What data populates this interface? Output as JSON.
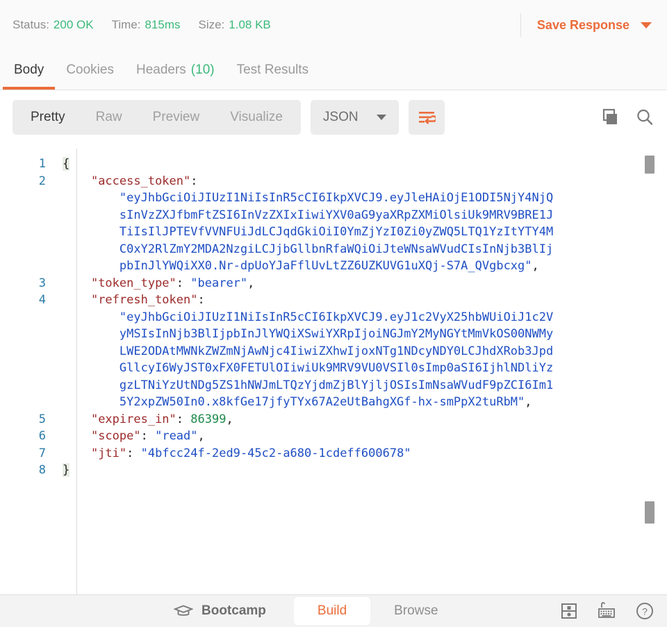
{
  "status_bar": {
    "status_label": "Status:",
    "status_value": "200 OK",
    "time_label": "Time:",
    "time_value": "815ms",
    "size_label": "Size:",
    "size_value": "1.08 KB",
    "save_response_label": "Save Response",
    "save_caret_icon": "chevron-down-icon",
    "accent_color": "#eb6c3a",
    "success_color": "#3bb97a"
  },
  "tabs": [
    {
      "label": "Body",
      "active": true,
      "count": ""
    },
    {
      "label": "Cookies",
      "active": false,
      "count": ""
    },
    {
      "label": "Headers",
      "active": false,
      "count": "(10)"
    },
    {
      "label": "Test Results",
      "active": false,
      "count": ""
    }
  ],
  "body_toolbar": {
    "view_modes": [
      {
        "label": "Pretty",
        "active": true
      },
      {
        "label": "Raw",
        "active": false
      },
      {
        "label": "Preview",
        "active": false
      },
      {
        "label": "Visualize",
        "active": false
      }
    ],
    "format_selected": "JSON",
    "format_caret_icon": "chevron-down-icon",
    "wrap_icon": "word-wrap-icon",
    "copy_icon": "copy-icon",
    "search_icon": "search-icon"
  },
  "code": {
    "language": "json",
    "line_numbers": [
      "1",
      "2",
      "",
      "",
      "",
      "",
      "",
      "3",
      "4",
      "",
      "",
      "",
      "",
      "",
      "5",
      "6",
      "7",
      "8"
    ],
    "lines": [
      {
        "num": "1",
        "segments": [
          {
            "t": "{",
            "c": "brace-hl"
          }
        ]
      },
      {
        "num": "2",
        "segments": [
          {
            "t": "    ",
            "c": "p"
          },
          {
            "t": "\"access_token\"",
            "c": "k"
          },
          {
            "t": ":",
            "c": "p"
          }
        ]
      },
      {
        "num": "",
        "segments": [
          {
            "t": "        ",
            "c": "p"
          },
          {
            "t": "\"eyJhbGciOiJIUzI1NiIsInR5cCI6IkpXVCJ9.eyJleHAiOjE1ODI5NjY4NjQ",
            "c": "s"
          }
        ]
      },
      {
        "num": "",
        "segments": [
          {
            "t": "        ",
            "c": "p"
          },
          {
            "t": "sInVzZXJfbmFtZSI6InVzZXIxIiwiYXV0aG9yaXRpZXMiOlsiUk9MRV9BRE1J",
            "c": "s"
          }
        ]
      },
      {
        "num": "",
        "segments": [
          {
            "t": "        ",
            "c": "p"
          },
          {
            "t": "TiIsIlJPTEVfVVNFUiJdLCJqdGkiOiI0YmZjYzI0Zi0yZWQ5LTQ1YzItYTY4M",
            "c": "s"
          }
        ]
      },
      {
        "num": "",
        "segments": [
          {
            "t": "        ",
            "c": "p"
          },
          {
            "t": "C0xY2RlZmY2MDA2NzgiLCJjbGllbnRfaWQiOiJteWNsaWVudCIsInNjb3BlIj",
            "c": "s"
          }
        ]
      },
      {
        "num": "",
        "segments": [
          {
            "t": "        ",
            "c": "p"
          },
          {
            "t": "pbInJlYWQiXX0.Nr-dpUoYJaFflUvLtZZ6UZKUVG1uXQj-S7A_QVgbcxg\"",
            "c": "s"
          },
          {
            "t": ",",
            "c": "p"
          }
        ]
      },
      {
        "num": "3",
        "segments": [
          {
            "t": "    ",
            "c": "p"
          },
          {
            "t": "\"token_type\"",
            "c": "k"
          },
          {
            "t": ": ",
            "c": "p"
          },
          {
            "t": "\"bearer\"",
            "c": "s"
          },
          {
            "t": ",",
            "c": "p"
          }
        ]
      },
      {
        "num": "4",
        "segments": [
          {
            "t": "    ",
            "c": "p"
          },
          {
            "t": "\"refresh_token\"",
            "c": "k"
          },
          {
            "t": ":",
            "c": "p"
          }
        ]
      },
      {
        "num": "",
        "segments": [
          {
            "t": "        ",
            "c": "p"
          },
          {
            "t": "\"eyJhbGciOiJIUzI1NiIsInR5cCI6IkpXVCJ9.eyJ1c2VyX25hbWUiOiJ1c2V",
            "c": "s"
          }
        ]
      },
      {
        "num": "",
        "segments": [
          {
            "t": "        ",
            "c": "p"
          },
          {
            "t": "yMSIsInNjb3BlIjpbInJlYWQiXSwiYXRpIjoiNGJmY2MyNGYtMmVkOS00NWMy",
            "c": "s"
          }
        ]
      },
      {
        "num": "",
        "segments": [
          {
            "t": "        ",
            "c": "p"
          },
          {
            "t": "LWE2ODAtMWNkZWZmNjAwNjc4IiwiZXhwIjoxNTg1NDcyNDY0LCJhdXRob3Jpd",
            "c": "s"
          }
        ]
      },
      {
        "num": "",
        "segments": [
          {
            "t": "        ",
            "c": "p"
          },
          {
            "t": "GllcyI6WyJST0xFX0FETUlOIiwiUk9MRV9VU0VSIl0sImp0aSI6IjhlNDliYz",
            "c": "s"
          }
        ]
      },
      {
        "num": "",
        "segments": [
          {
            "t": "        ",
            "c": "p"
          },
          {
            "t": "gzLTNiYzUtNDg5ZS1hNWJmLTQzYjdmZjBlYjljOSIsImNsaWVudF9pZCI6Im1",
            "c": "s"
          }
        ]
      },
      {
        "num": "",
        "segments": [
          {
            "t": "        ",
            "c": "p"
          },
          {
            "t": "5Y2xpZW50In0.x8kfGe17jfyTYx67A2eUtBahgXGf-hx-smPpX2tuRbM\"",
            "c": "s"
          },
          {
            "t": ",",
            "c": "p"
          }
        ]
      },
      {
        "num": "5",
        "segments": [
          {
            "t": "    ",
            "c": "p"
          },
          {
            "t": "\"expires_in\"",
            "c": "k"
          },
          {
            "t": ": ",
            "c": "p"
          },
          {
            "t": "86399",
            "c": "n"
          },
          {
            "t": ",",
            "c": "p"
          }
        ]
      },
      {
        "num": "6",
        "segments": [
          {
            "t": "    ",
            "c": "p"
          },
          {
            "t": "\"scope\"",
            "c": "k"
          },
          {
            "t": ": ",
            "c": "p"
          },
          {
            "t": "\"read\"",
            "c": "s"
          },
          {
            "t": ",",
            "c": "p"
          }
        ]
      },
      {
        "num": "7",
        "segments": [
          {
            "t": "    ",
            "c": "p"
          },
          {
            "t": "\"jti\"",
            "c": "k"
          },
          {
            "t": ": ",
            "c": "p"
          },
          {
            "t": "\"4bfcc24f-2ed9-45c2-a680-1cdeff600678\"",
            "c": "s"
          }
        ]
      },
      {
        "num": "8",
        "segments": [
          {
            "t": "}",
            "c": "brace-hl"
          }
        ]
      }
    ],
    "parsed_values": {
      "access_token": "eyJhbGciOiJIUzI1NiIsInR5cCI6IkpXVCJ9.eyJleHAiOjE1ODI5NjY4NjQsInVzZXJfbmFtZSI6InVzZXIxIiwiYXV0aG9yaXRpZXMiOlsiUk9MRV9BRE1JTiIsIlJPTEVfVVNFUiJdLCJqdGkiOiI0YmZjYzI0Zi0yZWQ5LTQ1YzItYTY4MC0xY2RlZmY2MDA2NzgiLCJjbGllbnRfaWQiOiJteWNsaWVudCIsInNjb3BlIjpbInJlYWQiXX0.Nr-dpUoYJaFflUvLtZZ6UZKUVG1uXQj-S7A_QVgbcxg",
      "token_type": "bearer",
      "refresh_token": "eyJhbGciOiJIUzI1NiIsInR5cCI6IkpXVCJ9.eyJ1c2VyX25hbWUiOiJ1c2VyMSIsInNjb3BlIjpbInJlYWQiXSwiYXRpIjoiNGJmY2MyNGYtMmVkOS00NWMyLWE2ODAtMWNkZWZmNjAwNjc4IiwiZXhwIjoxNTg1NDcyNDY0LCJhdXRob3JpdGllcyI6WyJST0xFX0FETUlOIiwiUk9MRV9VU0VSIl0sImp0aSI6IjhlNDliYzgzLTNiYzUtNDg5ZS1hNWJmLTQzYjdmZjBlYjljOSIsImNsaWVudF9pZCI6Im15Y2xpZW50In0.x8kfGe17jfyTYx67A2eUtBahgXGf-hx-smPpX2tuRbM",
      "expires_in": "86399",
      "scope": "read",
      "jti": "4bfcc24f-2ed9-45c2-a680-1cdeff600678"
    }
  },
  "bottom_bar": {
    "bootcamp_icon": "graduation-cap-icon",
    "bootcamp_label": "Bootcamp",
    "modes": [
      {
        "label": "Build",
        "active": true
      },
      {
        "label": "Browse",
        "active": false
      }
    ],
    "layout_icon": "two-pane-layout-icon",
    "keyboard_icon": "keyboard-icon",
    "help_icon": "question-mark-icon"
  }
}
